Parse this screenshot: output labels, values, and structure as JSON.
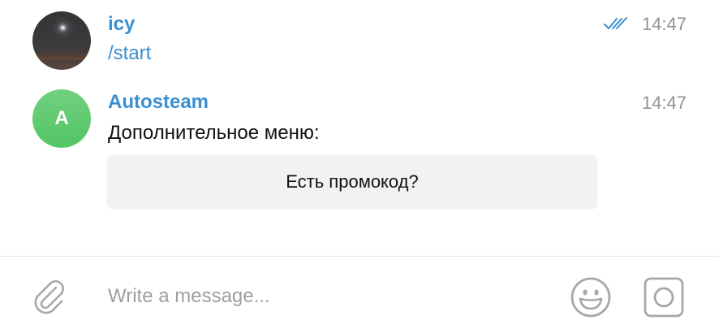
{
  "messages": [
    {
      "sender": "icy",
      "text": "/start",
      "time": "14:47",
      "read_status": "double-check-icon",
      "avatar": "profile-photo"
    },
    {
      "sender": "Autosteam",
      "avatar_letter": "A",
      "text": "Дополнительное меню:",
      "time": "14:47",
      "keyboard": [
        {
          "label": "Есть промокод?"
        }
      ]
    }
  ],
  "composer": {
    "placeholder": "Write a message...",
    "value": "",
    "attach_icon": "paperclip-icon",
    "emoji_icon": "emoji-icon",
    "camera_icon": "camera-icon"
  },
  "colors": {
    "accent": "#3a8fd0",
    "avatar_green": "#5ac86a",
    "timestamp": "#8e9499",
    "button_bg": "#f2f2f2",
    "icon_gray": "#a4a9ad"
  }
}
